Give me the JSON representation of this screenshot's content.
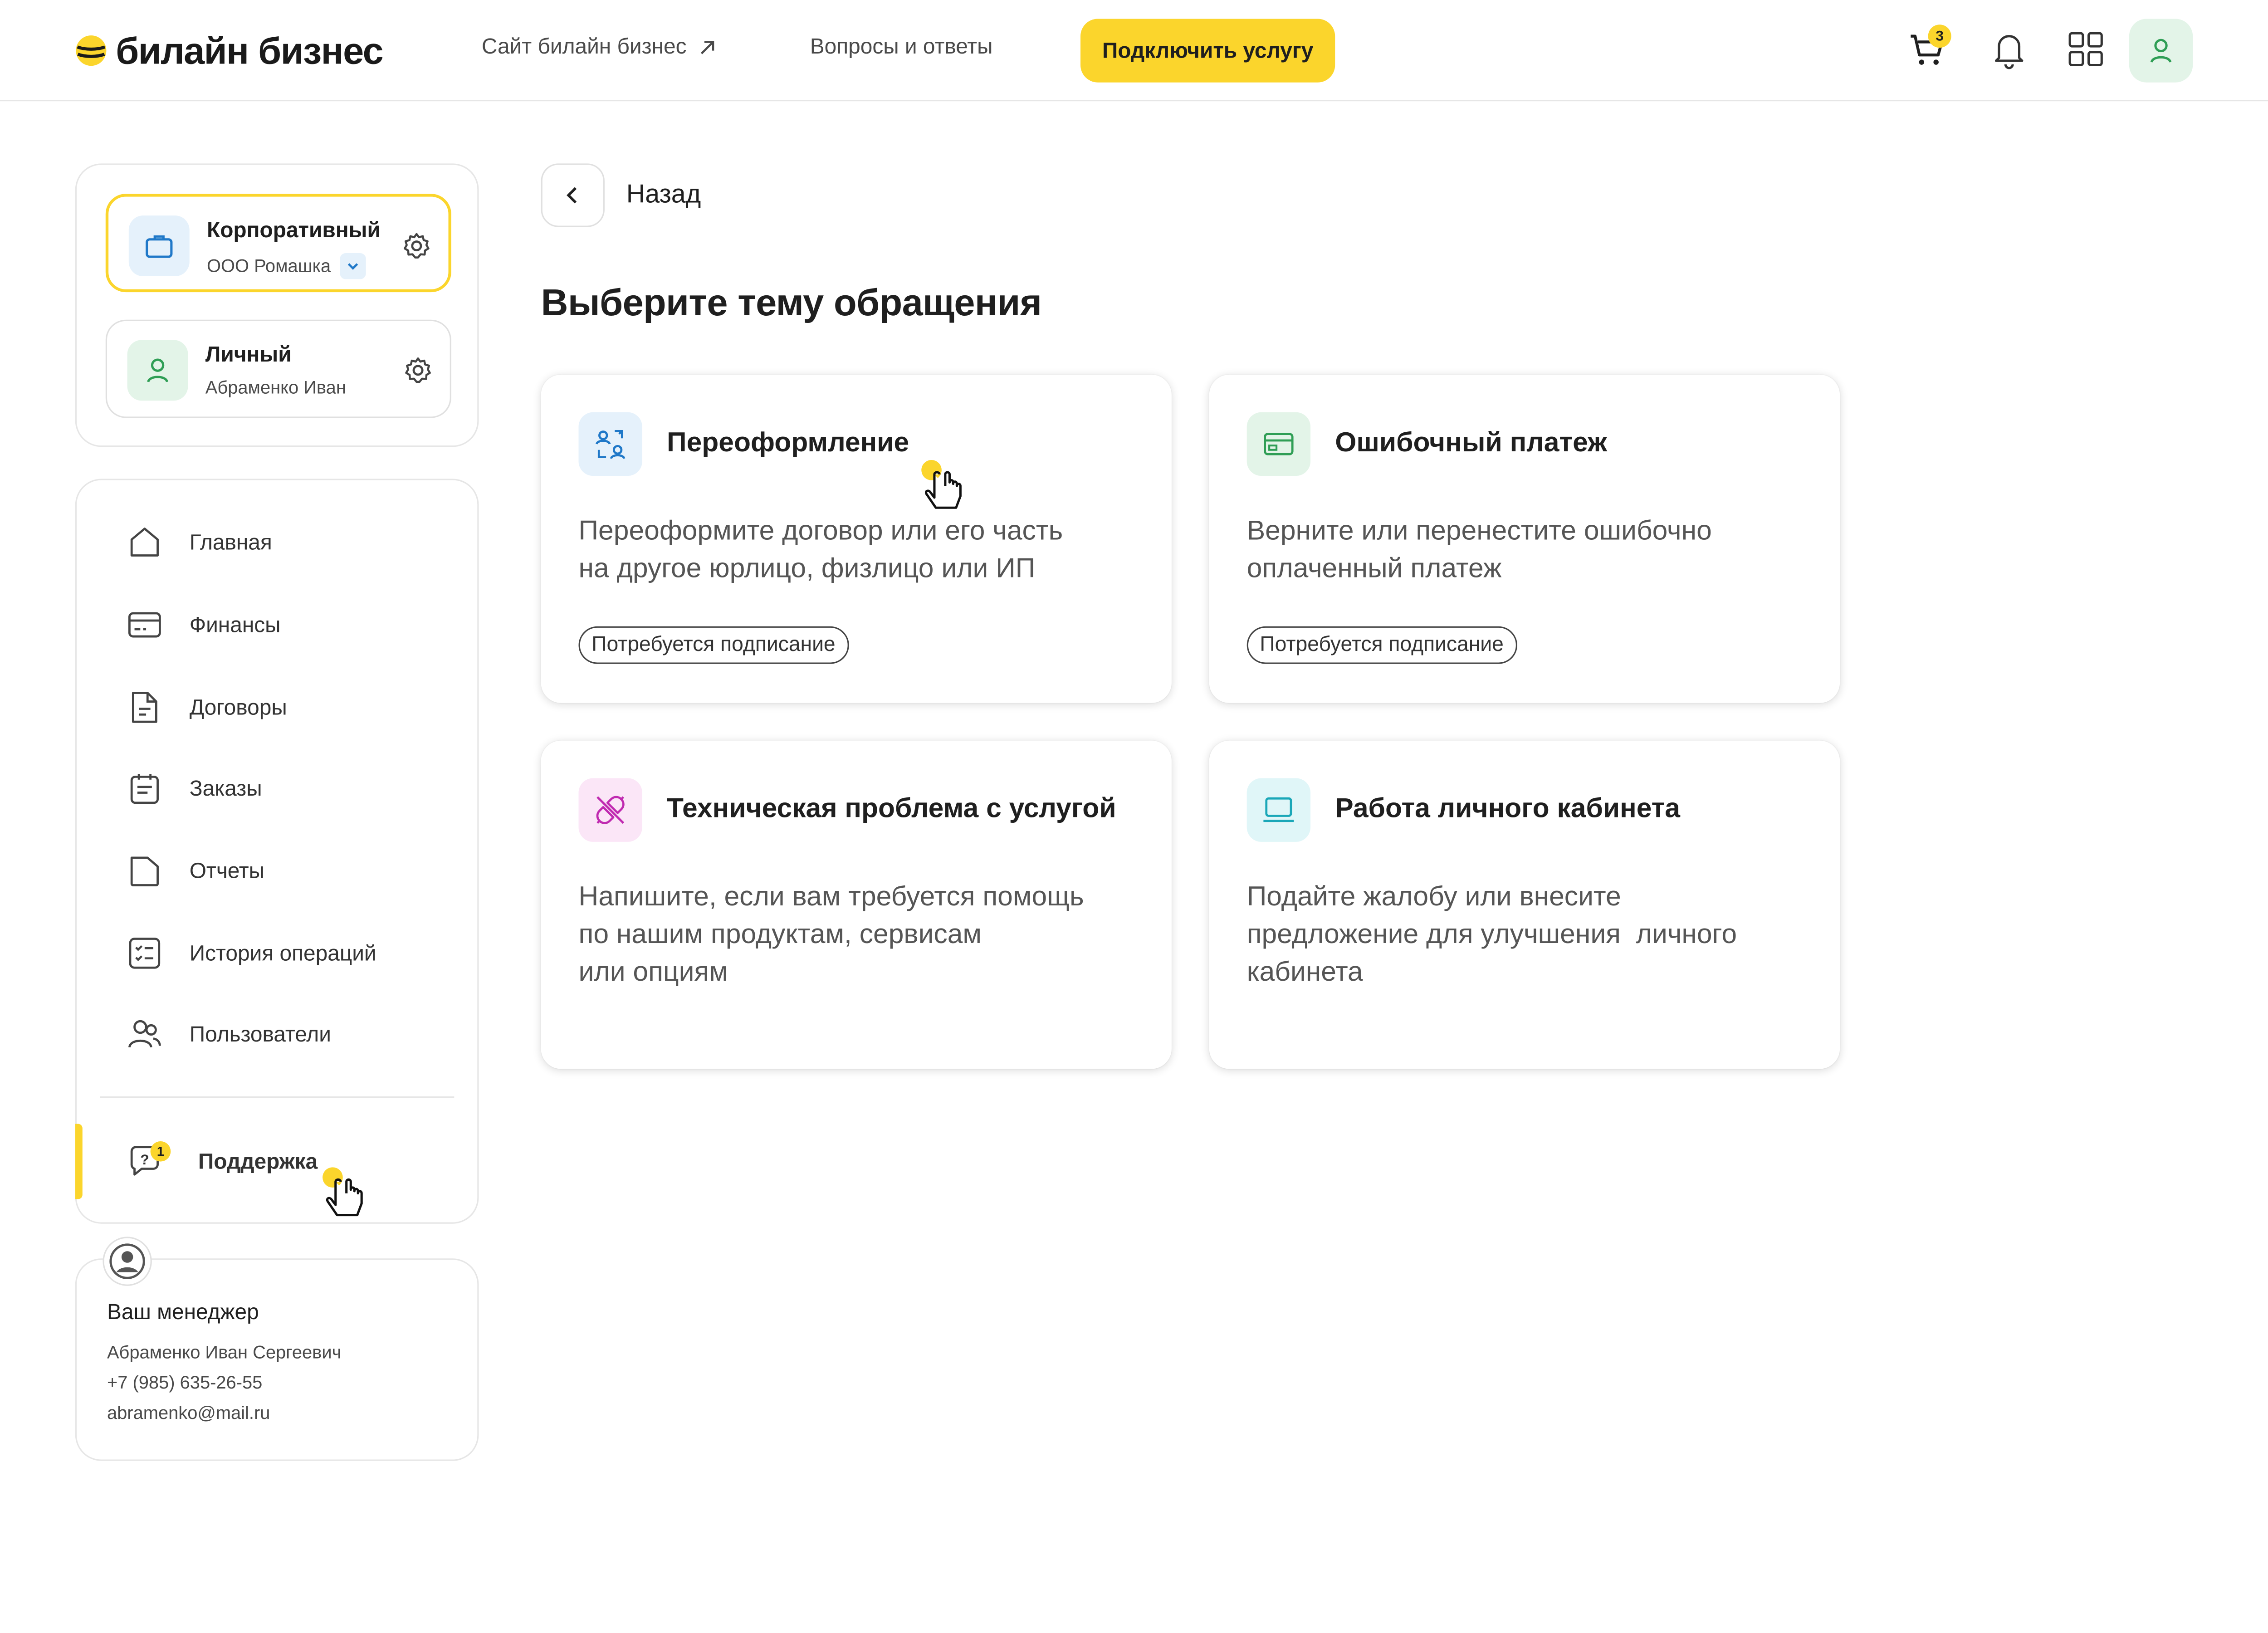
{
  "header": {
    "logo_text": "билайн бизнес",
    "nav": [
      {
        "label": "Сайт билайн бизнес"
      },
      {
        "label": "Вопросы и ответы"
      }
    ],
    "connect_button": "Подключить услугу",
    "cart_count": "3",
    "colors": {
      "accent": "#fbd52c",
      "avatar_bg": "#e3f4e8"
    }
  },
  "accounts": [
    {
      "title": "Корпоративный",
      "subtitle": "ООО Ромашка",
      "icon": "briefcase-icon",
      "active": true
    },
    {
      "title": "Личный",
      "subtitle": "Абраменко Иван",
      "icon": "person-icon",
      "active": false
    }
  ],
  "menu": {
    "items": [
      {
        "label": "Главная",
        "icon": "home-icon"
      },
      {
        "label": "Финансы",
        "icon": "card-icon"
      },
      {
        "label": "Договоры",
        "icon": "document-icon"
      },
      {
        "label": "Заказы",
        "icon": "calendar-list-icon"
      },
      {
        "label": "Отчеты",
        "icon": "folder-icon"
      },
      {
        "label": "История операций",
        "icon": "checklist-icon"
      },
      {
        "label": "Пользователи",
        "icon": "users-icon"
      }
    ],
    "support": {
      "label": "Поддержка",
      "badge": "1",
      "icon": "chat-question-icon"
    }
  },
  "manager": {
    "title": "Ваш менеджер",
    "name": "Абраменко Иван Сергеевич",
    "phone": "+7 (985) 635-26-55",
    "email": "abramenko@mail.ru"
  },
  "main": {
    "back_label": "Назад",
    "title": "Выберите тему обращения",
    "topics": [
      {
        "title": "Переоформление",
        "desc_lines": [
          "Переоформите договор или его часть",
          "на другое юрлицо, физлицо или ИП"
        ],
        "badge": "Потребуется подписание",
        "icon": "users-swap-icon",
        "icon_bg": "#e5f1fb"
      },
      {
        "title": "Ошибочный платеж",
        "desc_lines": [
          "Верните или перенестите ошибочно",
          "оплаченный платеж"
        ],
        "badge": "Потребуется подписание",
        "icon": "payment-card-icon",
        "icon_bg": "#e3f4e8"
      },
      {
        "title": "Техническая проблема с услугой",
        "desc_lines": [
          "Напишите, если вам требуется помощь",
          "по нашим продуктам, сервисам",
          "или опциям"
        ],
        "icon": "broken-plug-icon",
        "icon_bg": "#fbe6f7"
      },
      {
        "title": "Работа личного кабинета",
        "desc_lines": [
          "Подайте жалобу или внесите",
          "предложение для улучшения  личного",
          "кабинета"
        ],
        "icon": "laptop-icon",
        "icon_bg": "#e0f6f8"
      }
    ]
  }
}
